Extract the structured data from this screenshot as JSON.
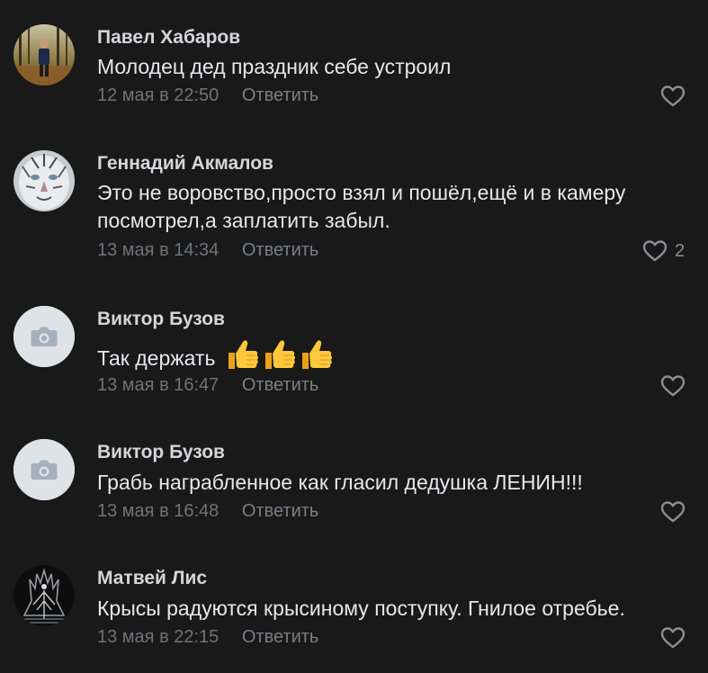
{
  "comments": [
    {
      "author": "Павел Хабаров",
      "text": "Молодец дед праздник себе устроил",
      "date": "12 мая в 22:50",
      "reply_label": "Ответить",
      "likes": "",
      "avatar": "photo-person-in-forest"
    },
    {
      "author": "Геннадий Акмалов",
      "text": "Это не воровство,просто взял и пошёл,ещё и в камеру посмотрел,а заплатить забыл.",
      "date": "13 мая в 14:34",
      "reply_label": "Ответить",
      "likes": "2",
      "avatar": "photo-white-tiger"
    },
    {
      "author": "Виктор Бузов",
      "text": "Так держать",
      "emoji": "👍👍👍",
      "date": "13 мая в 16:47",
      "reply_label": "Ответить",
      "likes": "",
      "avatar": "camera-placeholder-icon"
    },
    {
      "author": "Виктор Бузов",
      "text": "Грабь награбленное как гласил дедушка ЛЕНИН!!!",
      "date": "13 мая в 16:48",
      "reply_label": "Ответить",
      "likes": "",
      "avatar": "camera-placeholder-icon"
    },
    {
      "author": "Матвей Лис",
      "text": "Крысы радуются крысиному поступку. Гнилое отребье.",
      "date": "13 мая в 22:15",
      "reply_label": "Ответить",
      "likes": "",
      "avatar": "photo-dark-throne"
    }
  ],
  "colors": {
    "background": "#19191a",
    "author": "#d4d6d9",
    "text": "#e6e7ea",
    "meta": "#6f7378",
    "icon": "#8a8d92",
    "placeholder_avatar": "#dfe3e8"
  }
}
